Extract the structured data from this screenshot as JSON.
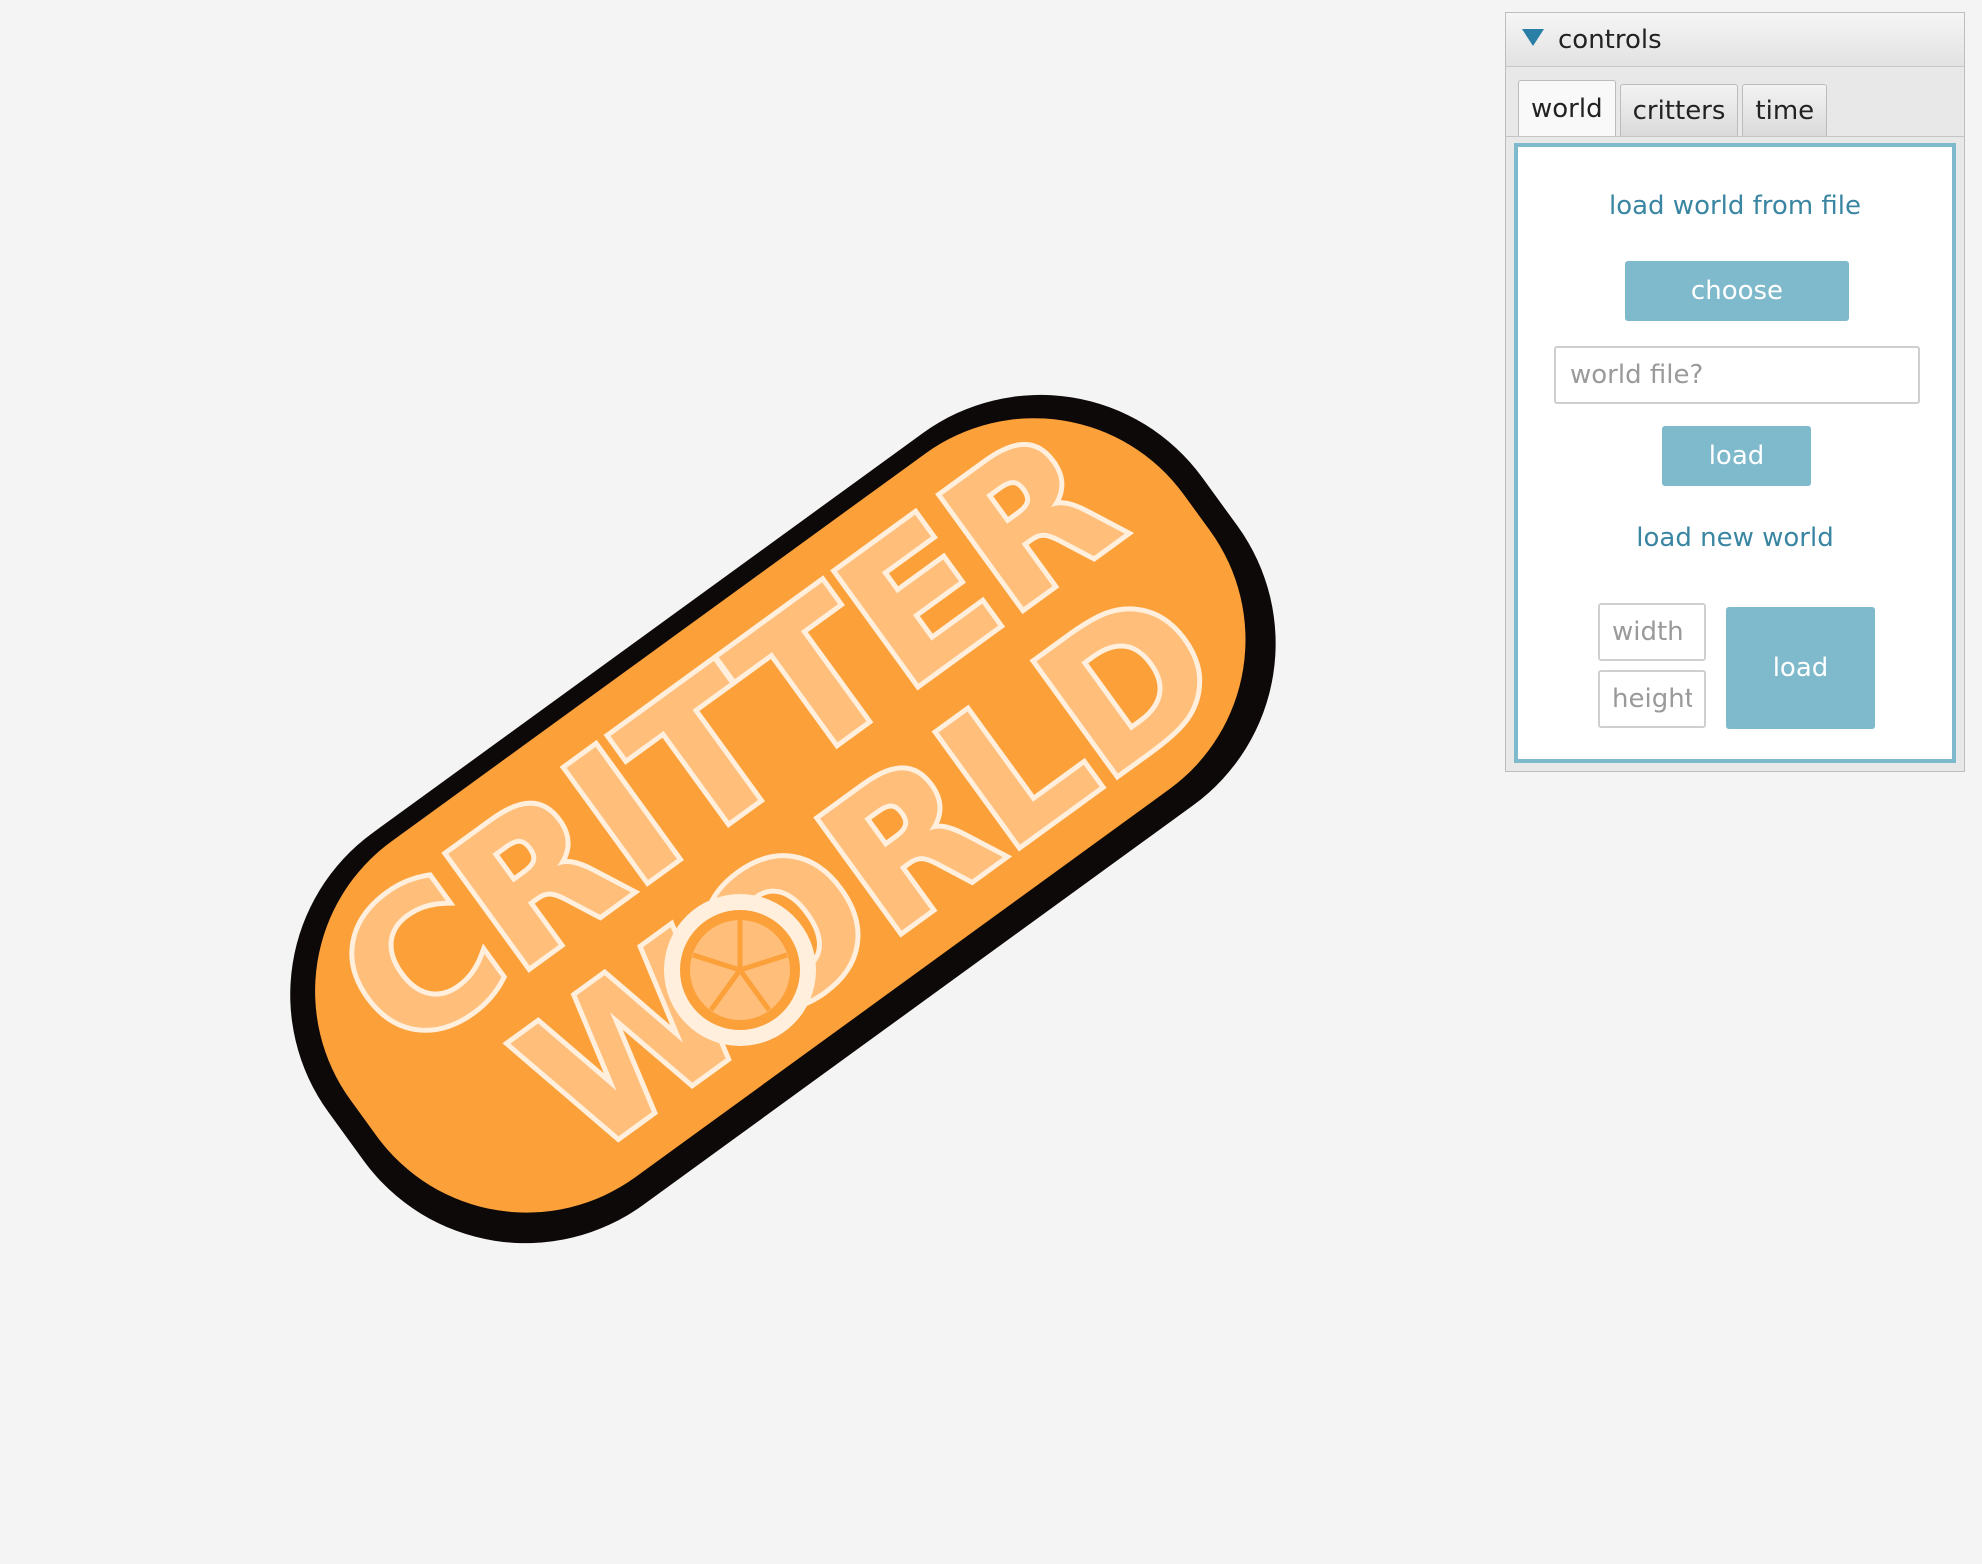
{
  "logo": {
    "line1": "CRITTER",
    "line2": "WORLD",
    "colors": {
      "outline": "#0d0908",
      "body": "#fca03a",
      "letter_fill": "#ffbe7a",
      "letter_edge": "#ffefdc"
    }
  },
  "controls": {
    "title": "controls",
    "tabs": [
      {
        "label": "world",
        "active": true
      },
      {
        "label": "critters",
        "active": false
      },
      {
        "label": "time",
        "active": false
      }
    ],
    "world_tab": {
      "load_from_file_label": "load world from file",
      "choose_label": "choose",
      "world_file_placeholder": "world file?",
      "load_file_label": "load",
      "load_new_label": "load new world",
      "width_placeholder": "width",
      "height_placeholder": "height",
      "load_new_button_label": "load"
    },
    "accent_color": "#7fb9cc",
    "label_color": "#3a86a2"
  }
}
